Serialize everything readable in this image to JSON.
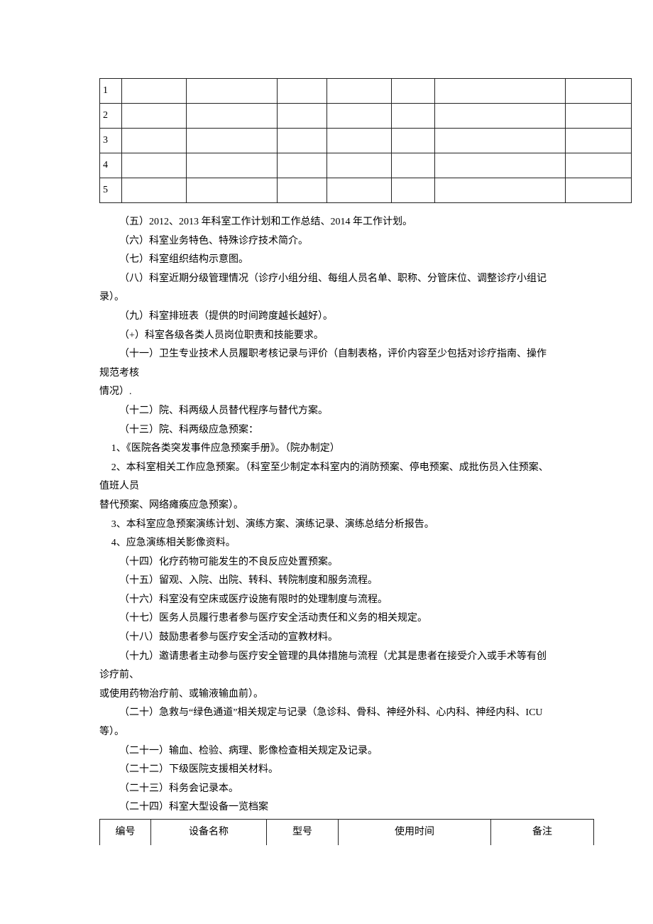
{
  "table1_rows": [
    "1",
    "2",
    "3",
    "4",
    "5"
  ],
  "paragraphs": {
    "p5": "（五）2012、2013 年科室工作计划和工作总结、2014 年工作计划。",
    "p6": "（六）科室业务特色、特殊诊疗技术简介。",
    "p7": "（七）科室组织结构示意图。",
    "p8": "（八）科室近期分级管理情况（诊疗小组分组、每组人员名单、职称、分管床位、调整诊疗小组记录）。",
    "p9": "（九）科室排班表（提供的时间跨度越长越好）。",
    "p10": "（+）科室各级各类人员岗位职责和技能要求。",
    "p11a": "（十一）卫生专业技术人员履职考核记录与评价（自制表格，评价内容至少包括对诊疗指南、操作规范考核",
    "p11b": "情况）.",
    "p12": "（十二）院、科两级人员替代程序与替代方案。",
    "p13": "（十三）院、科两级应急预案：",
    "n1": "1、《医院各类突发事件应急预案手册》。（院办制定）",
    "n2a": "2、本科室相关工作应急预案。（科室至少制定本科室内的消防预案、停电预案、成批伤员入住预案、值班人员",
    "n2b": "替代预案、网络瘫痪应急预案）。",
    "n3": "3、本科室应急预案演练计划、演练方案、演练记录、演练总结分析报告。",
    "n4": "4、应急演练相关影像资料。",
    "p14": "（十四）化疗药物可能发生的不良反应处置预案。",
    "p15": "（十五）留观、入院、出院、转科、转院制度和服务流程。",
    "p16": "（十六）科室没有空床或医疗设施有限时的处理制度与流程。",
    "p17": "（十七）医务人员履行患者参与医疗安全活动责任和义务的相关规定。",
    "p18": "（十八）鼓励患者参与医疗安全活动的宣教材料。",
    "p19a": "（十九）邀请患者主动参与医疗安全管理的具体措施与流程（尤其是患者在接受介入或手术等有创诊疗前、",
    "p19b": "或使用药物治疗前、或输液输血前）。",
    "p20": "（二十）急救与“绿色通道”相关规定与记录（急诊科、骨科、神经外科、心内科、神经内科、ICU 等）。",
    "p21": "（二十一）输血、检验、病理、影像检查相关规定及记录。",
    "p22": "（二十二）下级医院支援相关材料。",
    "p23": "（二十三）科务会记录本。",
    "p24": "（二十四）科室大型设备一览档案"
  },
  "table2_headers": {
    "h0": "编号",
    "h1": "设备名称",
    "h2": "型号",
    "h3": "使用时间",
    "h4": "备注"
  }
}
